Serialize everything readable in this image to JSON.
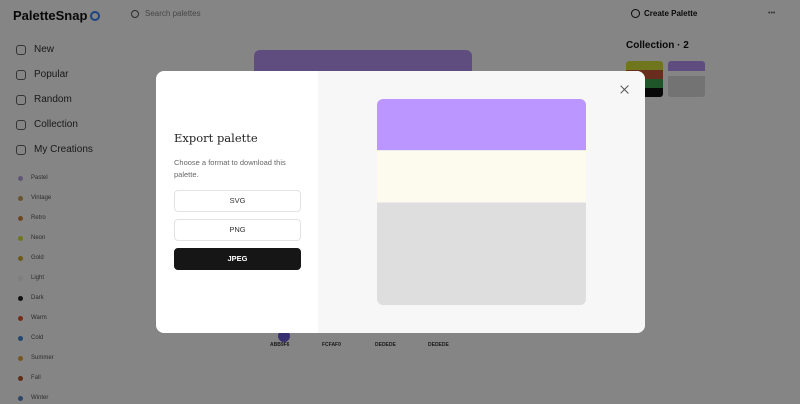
{
  "app": {
    "logo": "PaletteSnap",
    "search_placeholder": "Search palettes",
    "create_label": "Create Palette",
    "more_label": "•••"
  },
  "sidebar": {
    "nav": [
      {
        "label": "New",
        "icon": "sparkle-icon"
      },
      {
        "label": "Popular",
        "icon": "flame-icon"
      },
      {
        "label": "Random",
        "icon": "shuffle-icon"
      },
      {
        "label": "Collection",
        "icon": "bookmark-icon"
      },
      {
        "label": "My Creations",
        "icon": "brush-icon"
      }
    ],
    "tags": [
      {
        "label": "Pastel",
        "color": "#b9a6e6"
      },
      {
        "label": "Vintage",
        "color": "#c8a15a"
      },
      {
        "label": "Retro",
        "color": "#d08a3e"
      },
      {
        "label": "Neon",
        "color": "#d7e23a"
      },
      {
        "label": "Gold",
        "color": "#d4ac2b"
      },
      {
        "label": "Light",
        "color": "#f2f2f2"
      },
      {
        "label": "Dark",
        "color": "#222222"
      },
      {
        "label": "Warm",
        "color": "#e0562c"
      },
      {
        "label": "Cold",
        "color": "#3f8ad9"
      },
      {
        "label": "Summer",
        "color": "#e2a63c"
      },
      {
        "label": "Fall",
        "color": "#b8562a"
      },
      {
        "label": "Winter",
        "color": "#5b87c7"
      }
    ]
  },
  "collection": {
    "title": "Collection · 2",
    "palettes": [
      [
        "#d7e23a",
        "#c9573a",
        "#3fa452",
        "#111111"
      ],
      [
        "#b794f6",
        "#dcdcdc"
      ]
    ]
  },
  "feed": {
    "cards": [
      {
        "label": "ABB9F6"
      },
      {
        "label": "FCFAF0"
      },
      {
        "label": "DEDEDE"
      },
      {
        "label": "DEDEDE"
      }
    ]
  },
  "modal": {
    "title": "Export palette",
    "description": "Choose a format to download this palette.",
    "formats": [
      {
        "label": "SVG",
        "active": false
      },
      {
        "label": "PNG",
        "active": false
      },
      {
        "label": "JPEG",
        "active": true
      }
    ],
    "preview_colors": [
      "#bc96ff",
      "#fcfbee",
      "#dedede"
    ],
    "preview_weights": [
      1,
      1,
      2
    ]
  }
}
